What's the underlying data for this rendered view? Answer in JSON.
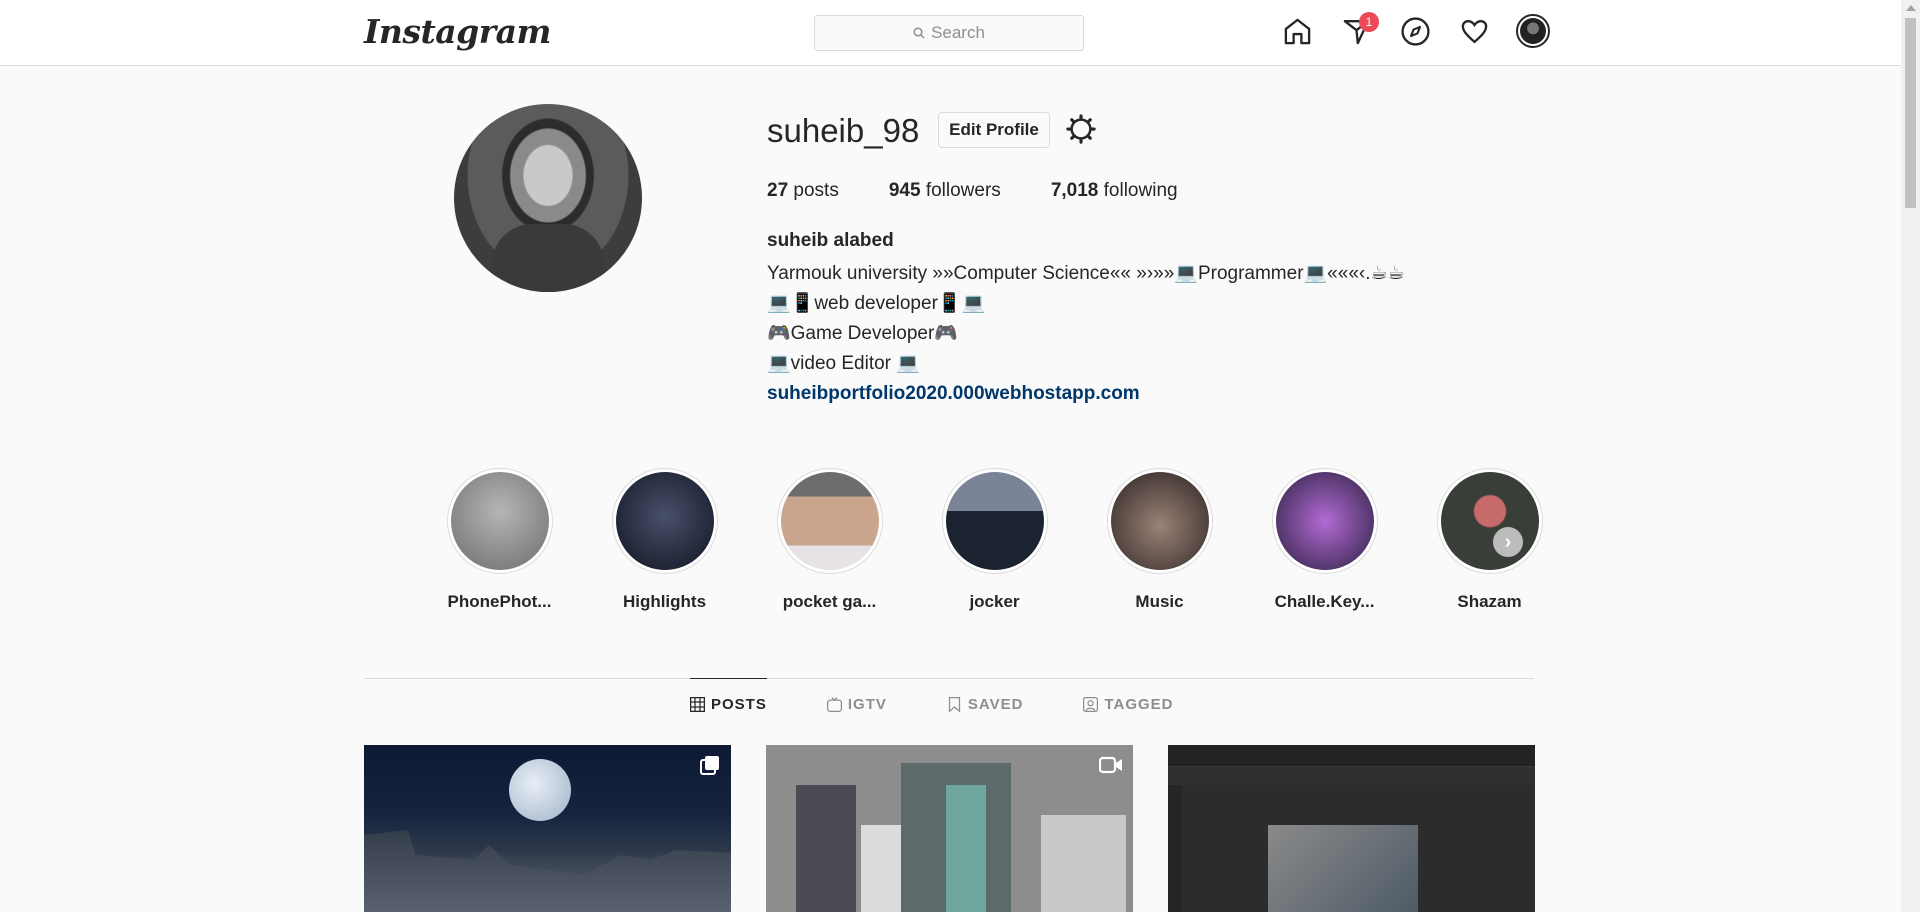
{
  "nav": {
    "logo": "Instagram",
    "search_placeholder": "Search",
    "messages_badge": "1",
    "icons": [
      "home-icon",
      "direct-messages-icon",
      "explore-icon",
      "activity-heart-icon",
      "profile-avatar-icon"
    ]
  },
  "profile": {
    "username": "suheib_98",
    "edit_label": "Edit Profile",
    "settings_icon": "settings-gear-icon",
    "stats": {
      "posts_count": "27",
      "posts_label": "posts",
      "followers_count": "945",
      "followers_label": "followers",
      "following_count": "7,018",
      "following_label": "following"
    },
    "full_name": "suheib alabed",
    "bio_lines": [
      "Yarmouk university »»Computer Science«« »›»»💻Programmer💻«««‹.☕☕",
      "💻📱web developer📱💻",
      "🎮Game Developer🎮",
      "💻video Editor 💻"
    ],
    "website": "suheibportfolio2020.000webhostapp.com"
  },
  "highlights": [
    {
      "label": "PhonePhot...",
      "color": "#8c8c8c"
    },
    {
      "label": "Highlights",
      "color": "#1c2230"
    },
    {
      "label": "pocket ga...",
      "color": "#b89a84"
    },
    {
      "label": "jocker",
      "color": "#2b3447"
    },
    {
      "label": "Music",
      "color": "#5a4a48"
    },
    {
      "label": "Challe.Key...",
      "color": "#5b4a7a"
    },
    {
      "label": "Shazam",
      "color": "#3b3f3a"
    }
  ],
  "tabs": [
    {
      "label": "POSTS",
      "icon": "grid-icon",
      "active": true
    },
    {
      "label": "IGTV",
      "icon": "igtv-icon",
      "active": false
    },
    {
      "label": "SAVED",
      "icon": "bookmark-icon",
      "active": false
    },
    {
      "label": "TAGGED",
      "icon": "tagged-user-icon",
      "active": false
    }
  ],
  "posts": [
    {
      "type": "carousel",
      "type_icon": "carousel-icon"
    },
    {
      "type": "video",
      "type_icon": "video-camera-icon"
    },
    {
      "type": "image",
      "type_icon": ""
    }
  ]
}
